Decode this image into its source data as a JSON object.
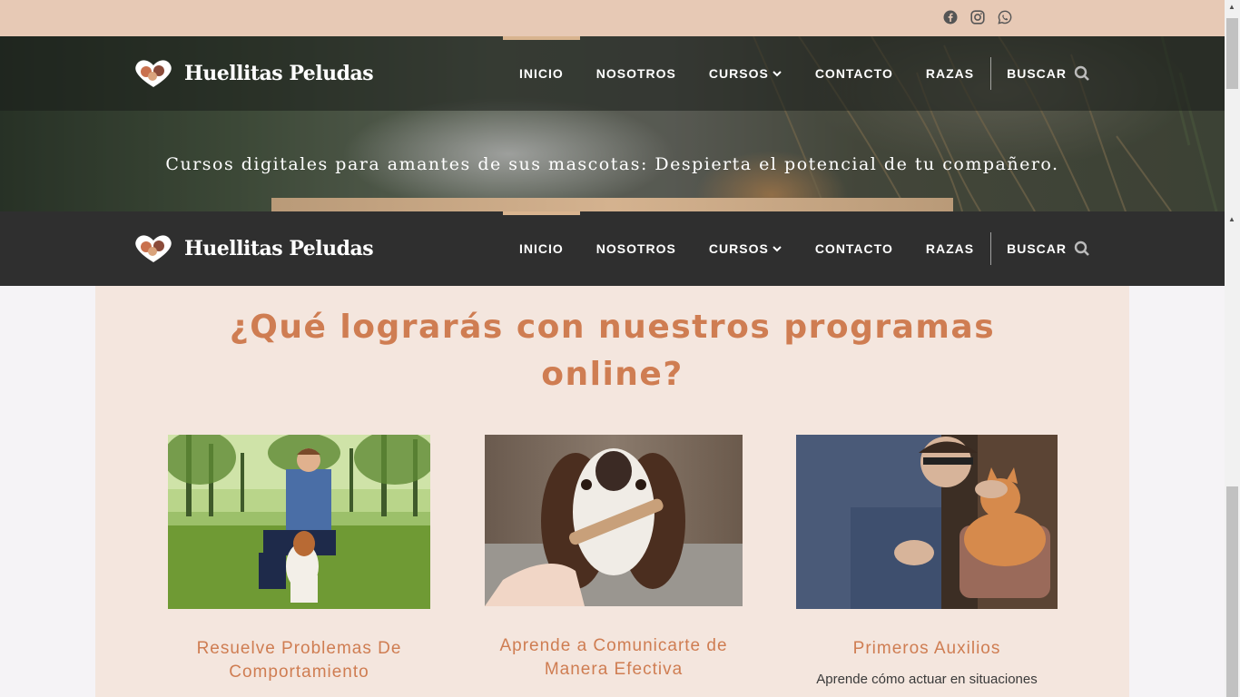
{
  "social": {
    "icons": [
      "facebook-icon",
      "instagram-icon",
      "whatsapp-icon"
    ]
  },
  "brand": {
    "name": "Huellitas Peludas",
    "logo_icon": "heart-dog-cat-logo"
  },
  "nav": {
    "items": [
      {
        "label": "INICIO",
        "active": true
      },
      {
        "label": "NOSOTROS"
      },
      {
        "label": "CURSOS",
        "has_dropdown": true
      },
      {
        "label": "CONTACTO"
      },
      {
        "label": "RAZAS"
      }
    ],
    "search_label": "BUSCAR"
  },
  "hero": {
    "tagline": "Cursos digitales para amantes de sus mascotas: Despierta el potencial de tu compañero."
  },
  "section": {
    "heading_line1": "¿Qué lograrás con nuestros programas",
    "heading_line2": "online?",
    "cards": [
      {
        "title_line1": "Resuelve Problemas De",
        "title_line2": "Comportamiento",
        "text": ""
      },
      {
        "title_line1": "Aprende a Comunicarte de",
        "title_line2": "Manera Efectiva",
        "text": ""
      },
      {
        "title_line1": "Primeros Auxilios",
        "title_line2": "",
        "text": "Aprende cómo actuar en situaciones"
      }
    ]
  },
  "colors": {
    "topbar": "#e7c9b5",
    "accent": "#cf7d52",
    "nav_dark": "#2f2f2f",
    "content_bg": "#f4e6de",
    "active_indicator": "#d9b48f"
  }
}
